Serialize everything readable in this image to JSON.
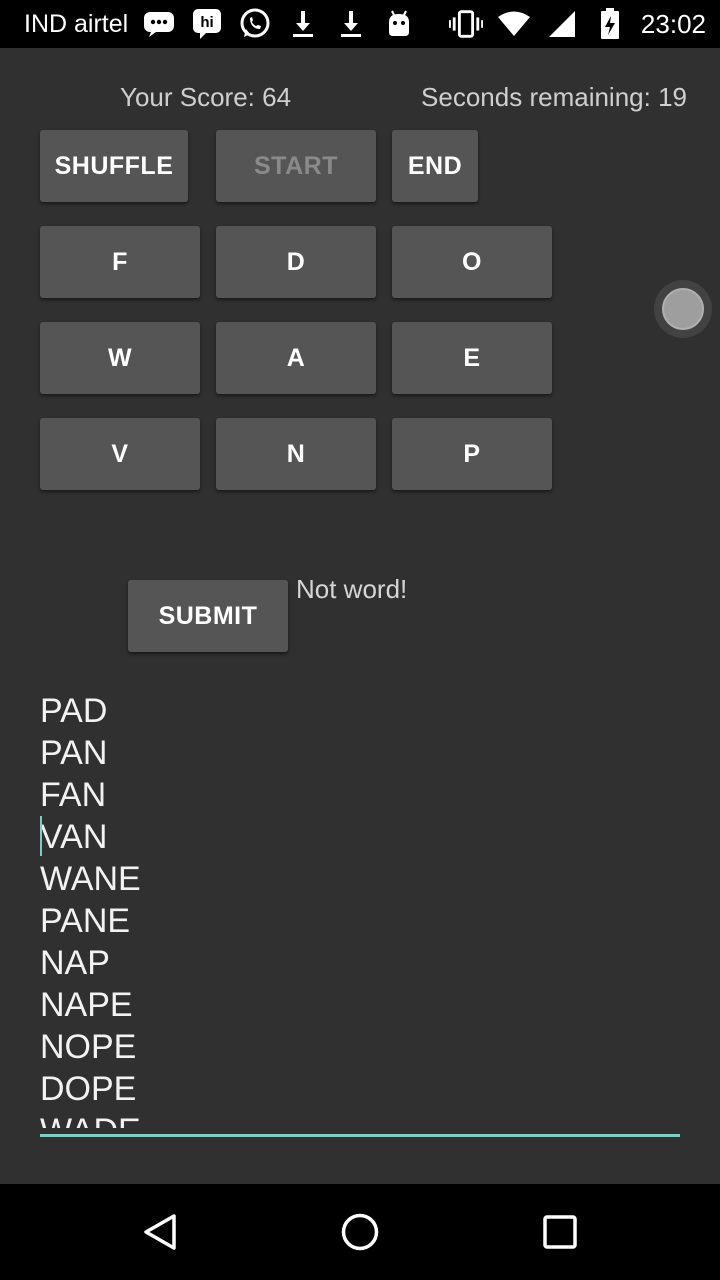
{
  "status_bar": {
    "carrier": "IND airtel",
    "time": "23:02",
    "icons": [
      "message-icon",
      "hike-icon",
      "whatsapp-icon",
      "download-icon",
      "download-icon",
      "android-icon",
      "vibrate-icon",
      "wifi-icon",
      "signal-icon",
      "battery-icon"
    ]
  },
  "game": {
    "score_text": "Your Score: 64",
    "seconds_text": "Seconds remaining: 19",
    "controls": {
      "shuffle": "SHUFFLE",
      "start": "START",
      "end": "END",
      "submit": "SUBMIT"
    },
    "letters": [
      "F",
      "D",
      "O",
      "W",
      "A",
      "E",
      "V",
      "N",
      "P"
    ],
    "message": "Not  word!",
    "words": [
      "PAD",
      "PAN",
      "FAN",
      "VAN",
      "WANE",
      "PANE",
      "NAP",
      "NAPE",
      "NOPE",
      "DOPE",
      "WADE"
    ]
  },
  "colors": {
    "background": "#303030",
    "button": "#555555",
    "accent": "#80cbc4"
  }
}
